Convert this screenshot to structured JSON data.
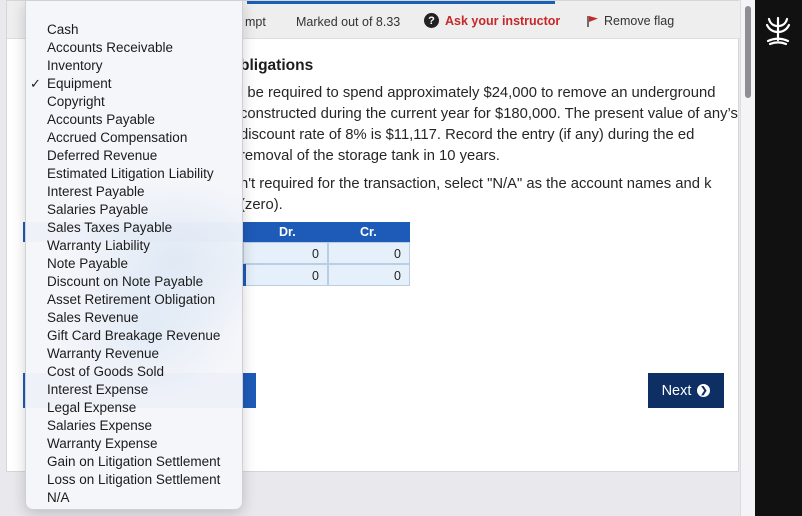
{
  "topbar": {
    "attempt_fragment": "mpt",
    "marked": "Marked out of 8.33",
    "ask_instructor": "Ask your instructor",
    "remove_flag": "Remove flag"
  },
  "question": {
    "heading": "bligations",
    "para1": "l be required to spend approximately $24,000 to remove an underground constructed during the current year for $180,000. The present value of any’s discount rate of 8% is $11,117. Record the entry (if any) during the ed removal of the storage tank in 10 years.",
    "para2": "n't required for the transaction, select \"N/A\" as the account names and k (zero)."
  },
  "journal": {
    "dr_header": "Dr.",
    "cr_header": "Cr.",
    "rows": [
      {
        "dr": "0",
        "cr": "0"
      },
      {
        "dr": "0",
        "cr": "0"
      }
    ]
  },
  "buttons": {
    "next": "Next"
  },
  "dropdown": {
    "selected": "Equipment",
    "options": [
      "Cash",
      "Accounts Receivable",
      "Inventory",
      "Equipment",
      "Copyright",
      "Accounts Payable",
      "Accrued Compensation",
      "Deferred Revenue",
      "Estimated Litigation Liability",
      "Interest Payable",
      "Salaries Payable",
      "Sales Taxes Payable",
      "Warranty Liability",
      "Note Payable",
      "Discount on Note Payable",
      "Asset Retirement Obligation",
      "Sales Revenue",
      "Gift Card Breakage Revenue",
      "Warranty Revenue",
      "Cost of Goods Sold",
      "Interest Expense",
      "Legal Expense",
      "Salaries Expense",
      "Warranty Expense",
      "Gain on Litigation Settlement",
      "Loss on Litigation Settlement",
      "N/A"
    ]
  },
  "colors": {
    "accent_blue": "#1e5bb8",
    "next_button": "#0d2f63",
    "ask_red": "#c62828"
  }
}
